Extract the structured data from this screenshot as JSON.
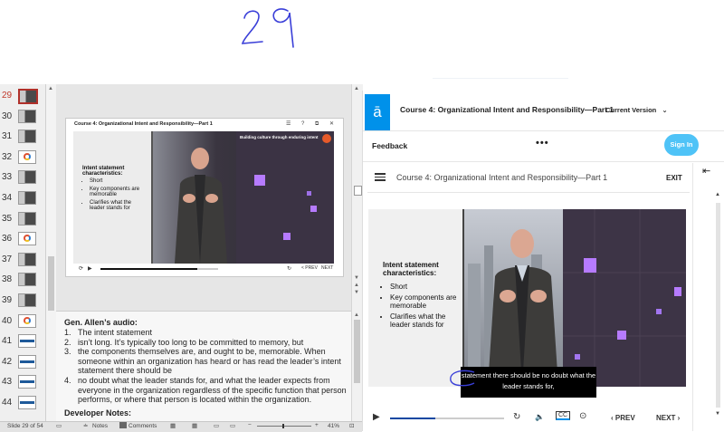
{
  "handwriting": {
    "text": "29"
  },
  "ppt": {
    "thumbnails": [
      {
        "num": "29",
        "selected": true,
        "kind": "video"
      },
      {
        "num": "30",
        "kind": "video"
      },
      {
        "num": "31",
        "kind": "video"
      },
      {
        "num": "32",
        "kind": "chart"
      },
      {
        "num": "33",
        "kind": "video"
      },
      {
        "num": "34",
        "kind": "video"
      },
      {
        "num": "35",
        "kind": "video"
      },
      {
        "num": "36",
        "kind": "chart"
      },
      {
        "num": "37",
        "kind": "video"
      },
      {
        "num": "38",
        "kind": "video"
      },
      {
        "num": "39",
        "kind": "video"
      },
      {
        "num": "40",
        "kind": "chart"
      },
      {
        "num": "41",
        "kind": "blue"
      },
      {
        "num": "42",
        "kind": "blue"
      },
      {
        "num": "43",
        "kind": "blue"
      },
      {
        "num": "44",
        "kind": "blue"
      }
    ],
    "slide": {
      "title": "Course 4: Organizational Intent and Responsibility—Part 1",
      "icons": "☰ ? ⧉ ✕",
      "banner": "Building culture through enduring intent",
      "heading": "Intent statement characteristics:",
      "bullets": [
        "Short",
        "Key components are memorable",
        "Clarifies what the leader stands for"
      ],
      "prev": "< PREV",
      "next": "NEXT"
    },
    "notes": {
      "heading": "Gen. Allen’s audio:",
      "items": [
        {
          "n": "1.",
          "text": "The intent statement"
        },
        {
          "n": "2.",
          "text": "isn’t long. It’s typically too long to be committed to memory, but"
        },
        {
          "n": "3.",
          "text": "the components themselves are, and ought to be, memorable. When someone within an organization has heard or has read the leader’s intent statement there should be"
        },
        {
          "n": "4.",
          "text": "no doubt what the leader stands for, and what the leader expects from everyone in the organization regardless of the specific function that person performs, or where that person is located within the organization."
        }
      ],
      "developer_heading": "Developer Notes:"
    },
    "status": {
      "slide": "Slide 29 of 54",
      "notes": "Notes",
      "comments": "Comments",
      "zoom": "41%"
    }
  },
  "player": {
    "logo": "ā",
    "course_title": "Course 4: Organizational Intent and Responsibility—Part 1",
    "version": "Current Version",
    "feedback": "Feedback",
    "more": "•••",
    "sign_in": "Sign In",
    "lesson_title": "Course 4: Organizational Intent and Responsibility—Part 1",
    "exit": "EXIT",
    "video": {
      "heading": "Intent statement characteristics:",
      "bullets": [
        "Short",
        "Key components are memorable",
        "Clarifies what the leader stands for"
      ],
      "caption": "statement there should be no doubt what the leader stands for,"
    },
    "progress": 0.4,
    "cc": "CC",
    "prev": "PREV",
    "next": "NEXT"
  },
  "colors": {
    "accent": "#0091ea",
    "sign_in": "#4fc3f7",
    "purple_light": "#b67bff",
    "pen": "#3a3fd8"
  }
}
